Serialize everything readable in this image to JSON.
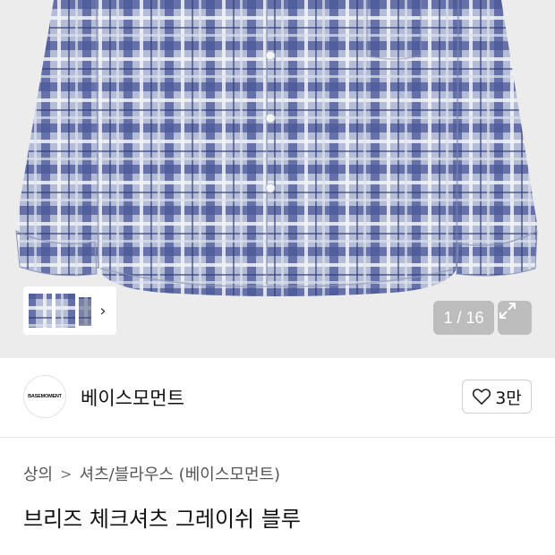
{
  "gallery": {
    "current_page": 1,
    "total_pages": 16,
    "pager_text": "1 / 16",
    "thumb_next_glyph": "›",
    "colors": {
      "shirt_base": "#a9b3cf",
      "check_dark": "#3b4a8a",
      "check_light": "#f2f3f6",
      "background": "#ececec"
    }
  },
  "brand": {
    "logo_text": "BASEMOMENT",
    "name": "베이스모먼트",
    "like_count": "3만",
    "like_icon": "heart-outline-icon"
  },
  "breadcrumb": {
    "category": "상의",
    "separator": ">",
    "subcategory": "셔츠/블라우스 (베이스모먼트)"
  },
  "product": {
    "title": "브리즈 체크셔츠 그레이쉬 블루"
  }
}
